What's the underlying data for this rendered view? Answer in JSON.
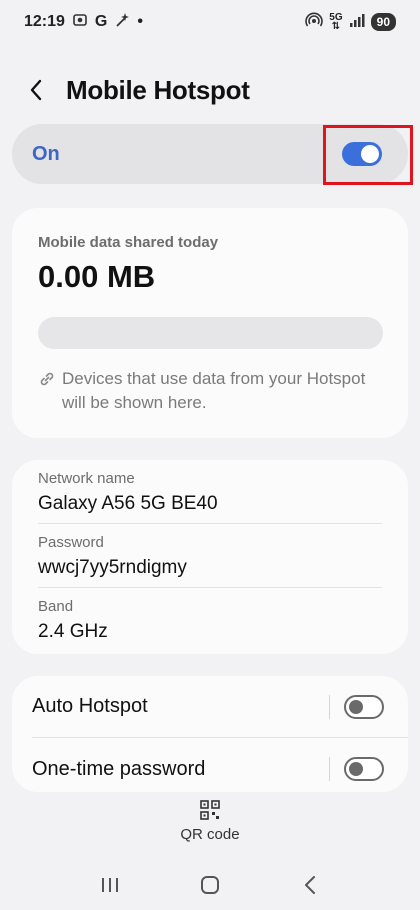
{
  "status_bar": {
    "time": "12:19",
    "icons_left": [
      "screenshot-icon",
      "google-icon",
      "magic-wand-icon",
      "dot-icon"
    ],
    "google_glyph": "G",
    "dot": "•",
    "network_type": "5G",
    "battery": "90"
  },
  "header": {
    "title": "Mobile Hotspot"
  },
  "master_switch": {
    "label": "On",
    "state": "on"
  },
  "usage": {
    "label": "Mobile data shared today",
    "value": "0.00 MB",
    "progress_fraction": 0,
    "devices_note": "Devices that use data from your Hotspot will be shown here."
  },
  "network": {
    "rows": [
      {
        "label": "Network name",
        "value": "Galaxy A56 5G BE40"
      },
      {
        "label": "Password",
        "value": "wwcj7yy5rndigmy"
      },
      {
        "label": "Band",
        "value": "2.4 GHz"
      }
    ]
  },
  "options": {
    "auto_hotspot": {
      "label": "Auto Hotspot",
      "state": "off"
    },
    "one_time_password": {
      "label": "One-time password",
      "state": "off"
    }
  },
  "qr": {
    "label": "QR code"
  },
  "colors": {
    "accent": "#3b6fdb",
    "label_blue": "#3e67c4",
    "highlight": "#e0141e"
  }
}
